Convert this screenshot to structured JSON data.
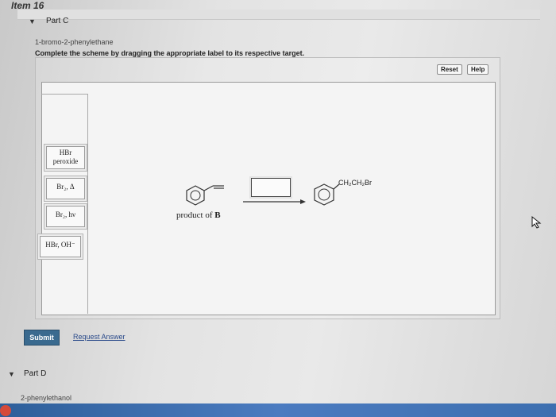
{
  "header": {
    "item_title": "Item 16"
  },
  "part_c": {
    "label": "Part C",
    "subtitle": "1-bromo-2-phenylethane",
    "instruction": "Complete the scheme by dragging the appropriate label to its respective target.",
    "reset_label": "Reset",
    "help_label": "Help"
  },
  "tiles": [
    {
      "line1": "HBr",
      "line2": "peroxide"
    },
    {
      "line1": "Br₂, Δ"
    },
    {
      "line1": "Br₂, hν"
    },
    {
      "line1": "HBr, OH⁻"
    }
  ],
  "scheme": {
    "product_prefix": "product of",
    "product_letter": "B",
    "final_group": "CH₂CH₂Br"
  },
  "actions": {
    "submit_label": "Submit",
    "request_label": "Request Answer"
  },
  "part_d": {
    "label": "Part D",
    "subtitle": "2-phenylethanol"
  },
  "icons": {
    "part_c_toggle": "caret-down-icon",
    "part_d_toggle": "caret-down-icon",
    "cursor": "mouse-cursor-icon",
    "taskbar_app": "app-circle-icon"
  },
  "colors": {
    "submit_bg": "#3a6a8f",
    "link": "#2a4a8a",
    "taskbar": "#2e5f9a"
  }
}
